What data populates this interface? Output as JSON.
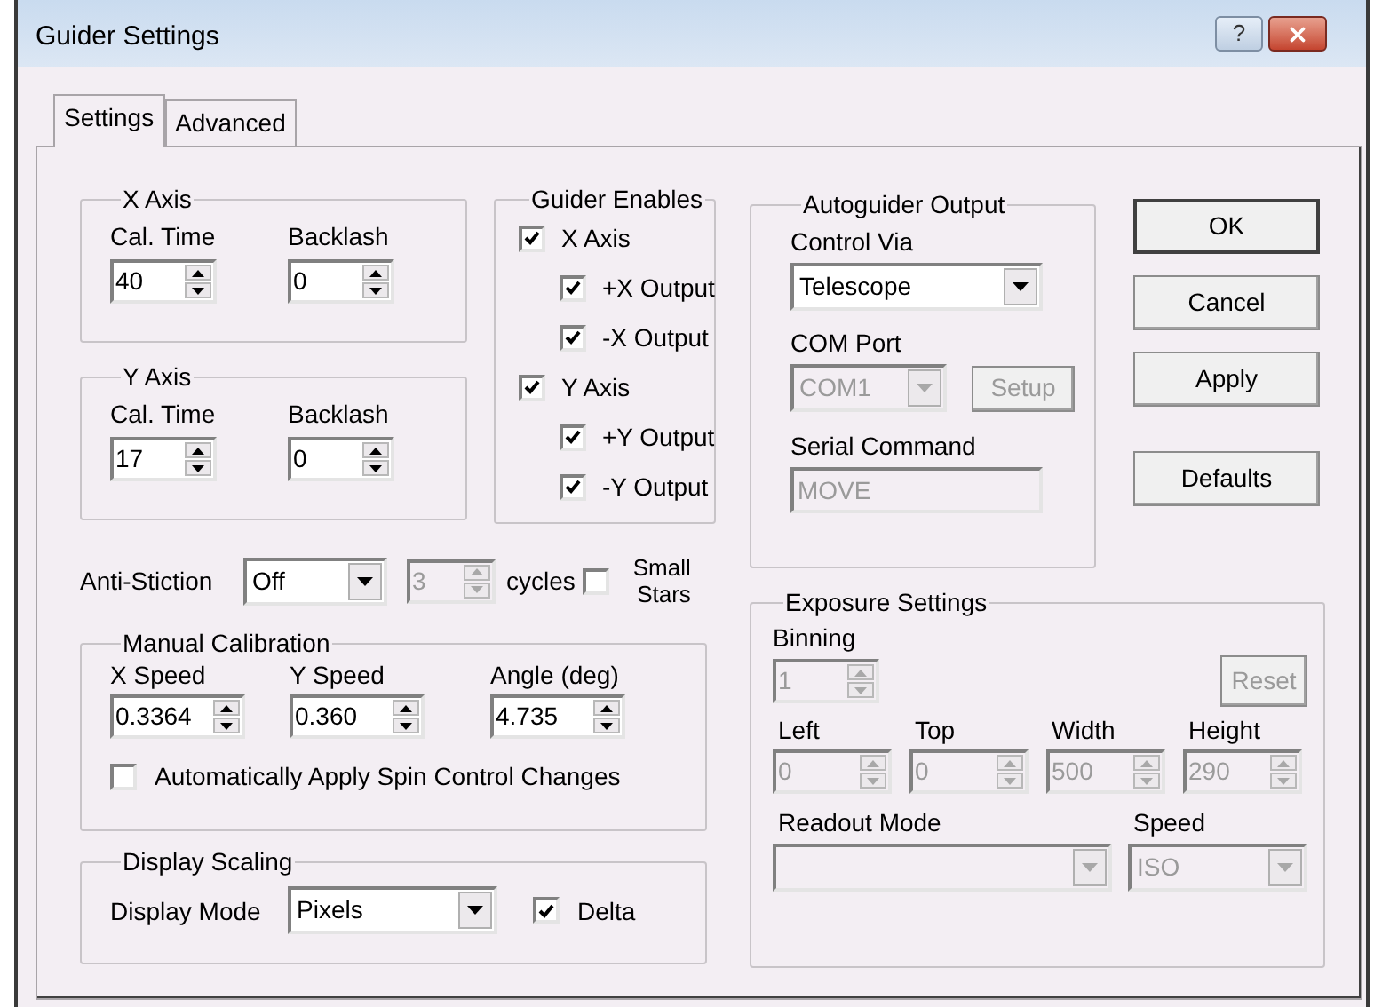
{
  "window": {
    "title": "Guider Settings",
    "help_label": "?"
  },
  "tabs": [
    {
      "label": "Settings",
      "selected": true
    },
    {
      "label": "Advanced",
      "selected": false
    }
  ],
  "x_axis": {
    "title": "X Axis",
    "fields": [
      {
        "label": "Cal. Time",
        "value": "40"
      },
      {
        "label": "Backlash",
        "value": "0"
      }
    ]
  },
  "y_axis": {
    "title": "Y Axis",
    "fields": [
      {
        "label": "Cal. Time",
        "value": "17"
      },
      {
        "label": "Backlash",
        "value": "0"
      }
    ]
  },
  "guider_enables": {
    "title": "Guider Enables",
    "items": [
      {
        "label": "X Axis",
        "checked": true,
        "children": [
          {
            "label": "+X Output",
            "checked": true
          },
          {
            "label": "-X Output",
            "checked": true
          }
        ]
      },
      {
        "label": "Y Axis",
        "checked": true,
        "children": [
          {
            "label": "+Y Output",
            "checked": true
          },
          {
            "label": "-Y Output",
            "checked": true
          }
        ]
      }
    ]
  },
  "anti_stiction": {
    "label": "Anti-Stiction",
    "mode": "Off",
    "cycles": {
      "value": "3",
      "disabled": true
    },
    "cycles_label": "cycles",
    "small_stars": {
      "label": "Small Stars",
      "checked": false
    }
  },
  "manual_calibration": {
    "title": "Manual Calibration",
    "fields": [
      {
        "label": "X Speed",
        "value": "0.3364"
      },
      {
        "label": "Y Speed",
        "value": "0.360"
      },
      {
        "label": "Angle (deg)",
        "value": "4.735"
      }
    ],
    "auto_apply": {
      "label": "Automatically Apply Spin Control Changes",
      "checked": false
    }
  },
  "display_scaling": {
    "title": "Display Scaling",
    "label": "Display Mode",
    "mode": "Pixels",
    "delta": {
      "label": "Delta",
      "checked": true
    }
  },
  "autoguider_output": {
    "title": "Autoguider Output",
    "control_via": {
      "label": "Control Via",
      "value": "Telescope",
      "disabled": false
    },
    "com_port": {
      "label": "COM Port",
      "value": "COM1",
      "disabled": true
    },
    "setup_button": {
      "label": "Setup",
      "disabled": true
    },
    "serial_command": {
      "label": "Serial Command",
      "value": "MOVE",
      "disabled": true
    }
  },
  "buttons": [
    {
      "label": "OK",
      "default": true
    },
    {
      "label": "Cancel",
      "default": false
    },
    {
      "label": "Apply",
      "default": false
    },
    {
      "label": "Defaults",
      "default": false
    }
  ],
  "exposure_settings": {
    "title": "Exposure Settings",
    "binning": {
      "label": "Binning",
      "value": "1",
      "disabled": true
    },
    "reset_button": {
      "label": "Reset",
      "disabled": true
    },
    "fields": [
      {
        "label": "Left",
        "value": "0",
        "disabled": true
      },
      {
        "label": "Top",
        "value": "0",
        "disabled": true
      },
      {
        "label": "Width",
        "value": "500",
        "disabled": true
      },
      {
        "label": "Height",
        "value": "290",
        "disabled": true
      }
    ],
    "readout_mode": {
      "label": "Readout Mode",
      "disabled": true
    },
    "speed": {
      "label": "Speed",
      "value": "ISO",
      "disabled": true
    }
  }
}
